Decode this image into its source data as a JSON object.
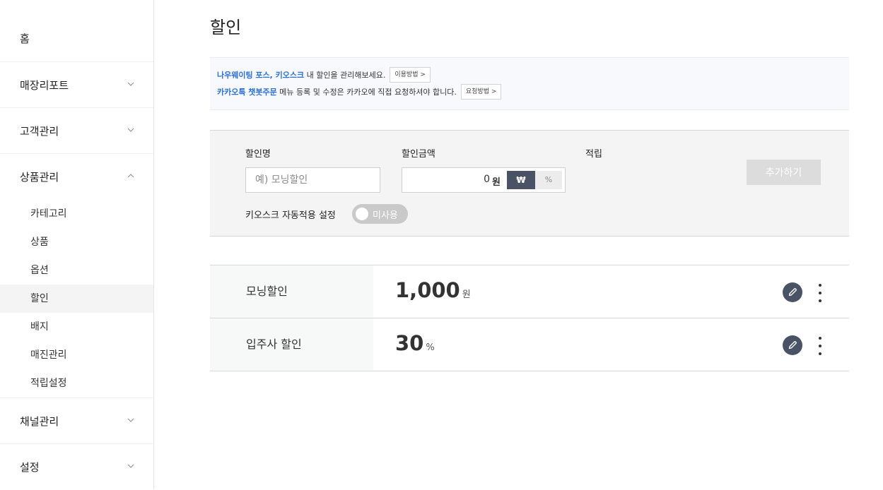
{
  "sidebar": {
    "home": "홈",
    "store_report": "매장리포트",
    "customer_mgmt": "고객관리",
    "product_mgmt": "상품관리",
    "product_sub": [
      "카테고리",
      "상품",
      "옵션",
      "할인",
      "배지",
      "매진관리",
      "적립설정"
    ],
    "channel_mgmt": "채널관리",
    "settings": "설정"
  },
  "page": {
    "title": "할인"
  },
  "notice": {
    "line1_highlight": "나우웨이팅 포스, 키오스크",
    "line1_text": " 내 할인을 관리해보세요.",
    "line1_button": "이용방법 >",
    "line2_highlight": "카카오톡 챗봇주문",
    "line2_text": " 메뉴 등록 및 수정은 카카오에 직접 요청하셔야 합니다.",
    "line2_button": "요청방법 >"
  },
  "form": {
    "name_label": "할인명",
    "name_placeholder": "예) 모닝할인",
    "amount_label": "할인금액",
    "amount_value": "0",
    "amount_unit": "원",
    "seg_won": "₩",
    "seg_pct": "%",
    "save_label": "적립",
    "add_button": "추가하기",
    "kiosk_label": "키오스크 자동적용 설정",
    "kiosk_toggle": "미사용"
  },
  "discounts": [
    {
      "name": "모닝할인",
      "amount": "1,000",
      "unit": "원"
    },
    {
      "name": "입주사 할인",
      "amount": "30",
      "unit": "%"
    }
  ],
  "colors": {
    "accent": "#2a6fd6",
    "dark": "#4a5366"
  }
}
